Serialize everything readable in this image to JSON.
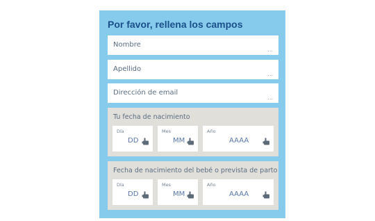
{
  "form": {
    "title": "Por favor, rellena los campos",
    "fields": {
      "nombre": {
        "placeholder": "Nombre",
        "trail": "..."
      },
      "apellido": {
        "placeholder": "Apellido",
        "trail": "..."
      },
      "email": {
        "placeholder": "Dirección de email",
        "trail": "..."
      }
    },
    "birth": {
      "caption": "Tu fecha de nacimiento",
      "day": {
        "label": "Día",
        "placeholder": "DD"
      },
      "month": {
        "label": "Mes",
        "placeholder": "MM"
      },
      "year": {
        "label": "Año",
        "placeholder": "AAAA"
      }
    },
    "baby": {
      "caption": "Fecha de nacimiento del bebé o prevista de parto",
      "day": {
        "label": "Día",
        "placeholder": "DD"
      },
      "month": {
        "label": "Mes",
        "placeholder": "MM"
      },
      "year": {
        "label": "Año",
        "placeholder": "AAAA"
      }
    }
  },
  "colors": {
    "panel": "#86cbeb",
    "title": "#1a4f8a",
    "date_box": "#e1dfd9"
  },
  "icons": {
    "date_picker": "hand-pointer-icon"
  }
}
